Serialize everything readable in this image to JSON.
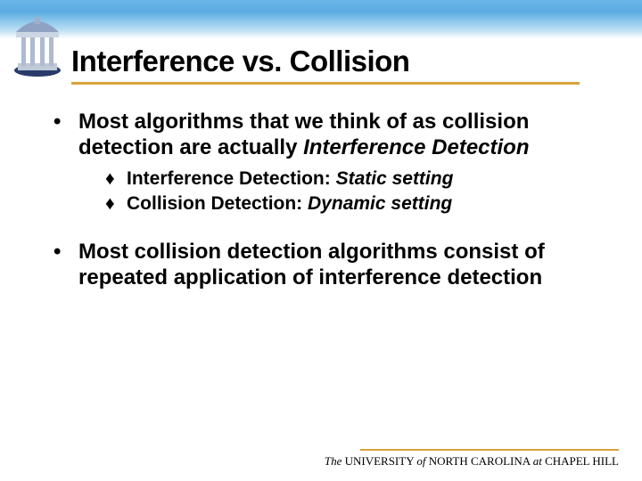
{
  "title": "Interference vs. Collision",
  "bullets": [
    {
      "lead": "Most algorithms that we think of as collision detection are actually ",
      "emphasis": "Interference Detection",
      "sub": [
        {
          "label": "Interference Detection: ",
          "italic": "Static setting"
        },
        {
          "label": "Collision Detection: ",
          "italic": "Dynamic setting"
        }
      ]
    },
    {
      "lead": "Most collision detection algorithms consist of repeated application of interference detection",
      "emphasis": "",
      "sub": []
    }
  ],
  "footer": {
    "the": "The",
    "univ": " UNIVERSITY ",
    "of": "of",
    "nc": " NORTH  CAROLINA ",
    "at": "at",
    "ch": " CHAPEL HILL"
  }
}
